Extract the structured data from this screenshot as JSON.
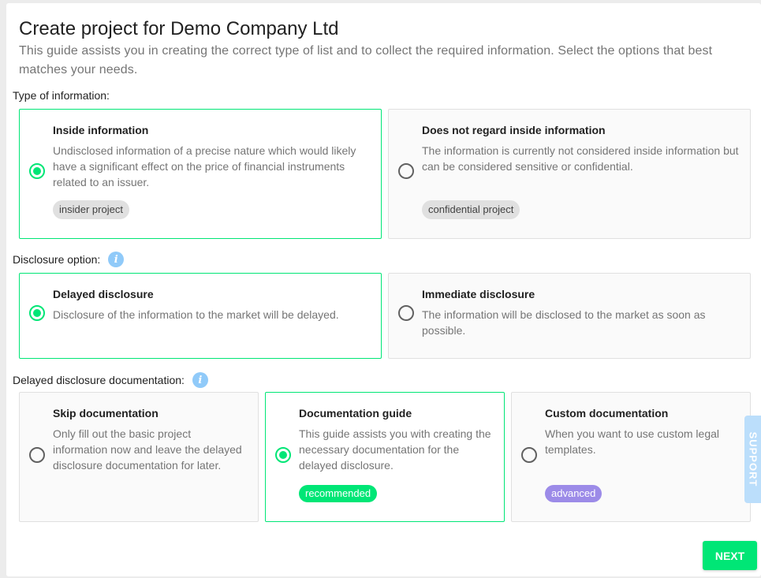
{
  "header": {
    "title": "Create project for Demo Company Ltd",
    "subtitle": "This guide assists you in creating the correct type of list and to collect the required information. Select the options that best matches your needs."
  },
  "type_section": {
    "label": "Type of information:",
    "options": [
      {
        "title": "Inside information",
        "description": "Undisclosed information of a precise nature which would likely have a significant effect on the price of financial instruments related to an issuer.",
        "chip": "insider project",
        "selected": true
      },
      {
        "title": "Does not regard inside information",
        "description": "The information is currently not considered inside information but can be considered sensitive or confidential.",
        "chip": "confidential project",
        "selected": false
      }
    ]
  },
  "disclosure_section": {
    "label": "Disclosure option:",
    "info_icon": "i",
    "options": [
      {
        "title": "Delayed disclosure",
        "description": "Disclosure of the information to the market will be delayed.",
        "selected": true
      },
      {
        "title": "Immediate disclosure",
        "description": "The information will be disclosed to the market as soon as possible.",
        "selected": false
      }
    ]
  },
  "documentation_section": {
    "label": "Delayed disclosure documentation:",
    "info_icon": "i",
    "options": [
      {
        "title": "Skip documentation",
        "description": "Only fill out the basic project information now and leave the delayed disclosure documentation for later.",
        "selected": false
      },
      {
        "title": "Documentation guide",
        "description": "This guide assists you with creating the necessary documentation for the delayed disclosure.",
        "chip": "recommended",
        "selected": true
      },
      {
        "title": "Custom documentation",
        "description": "When you want to use custom legal templates.",
        "chip": "advanced",
        "selected": false
      }
    ]
  },
  "support_tab": {
    "label": "SUPPORT"
  },
  "footer": {
    "next_label": "NEXT"
  },
  "colors": {
    "accent_green": "#00e676",
    "info_blue": "#90caf9",
    "advanced_purple": "#9c8be8"
  }
}
